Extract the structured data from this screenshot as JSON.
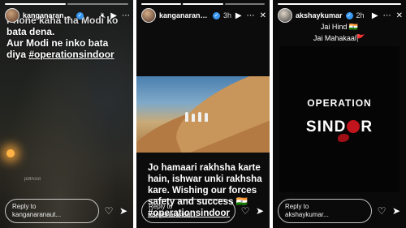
{
  "stories": [
    {
      "username": "kanganaranaut",
      "timestamp": "",
      "text_lines": [
        "Phone kaha tha Modi ko",
        "bata dena.",
        "Aur Modi ne inko bata",
        "diya"
      ],
      "hashtag": "#operationsindoor",
      "watermark": "pdfAsst",
      "reply_line1": "Reply to",
      "reply_line2": "kanganaranaut..."
    },
    {
      "username": "kanganaranaut",
      "timestamp": "3h",
      "text_lines": [
        "Jo hamaari rakhsha karte",
        "hain, ishwar unki rakhsha",
        "kare. Wishing our forces",
        "safety and success"
      ],
      "flag_emoji": "🇮🇳",
      "hashtag": "#operationsindoor",
      "reply_line1": "Reply to",
      "reply_line2": "kanganaranaut..."
    },
    {
      "username": "akshaykumar",
      "timestamp": "2h",
      "caption_line1": "Jai Hind",
      "caption_line2": "Jai Mahakaal",
      "flag_emoji": "🇮🇳",
      "saffron_flag_emoji": "🚩",
      "poster_line1": "OPERATION",
      "poster_sind": "SIND",
      "poster_or": "R",
      "reply_line1": "Reply to",
      "reply_line2": "akshaykumar..."
    }
  ],
  "icons": {
    "verified": "verified-badge-icon",
    "mute": "mute-icon",
    "play": "play-icon",
    "more": "more-icon",
    "close": "close-icon",
    "heart": "heart-icon",
    "send": "send-icon"
  },
  "colors": {
    "verified": "#3897f0",
    "sindoor_red": "#c2141c"
  }
}
